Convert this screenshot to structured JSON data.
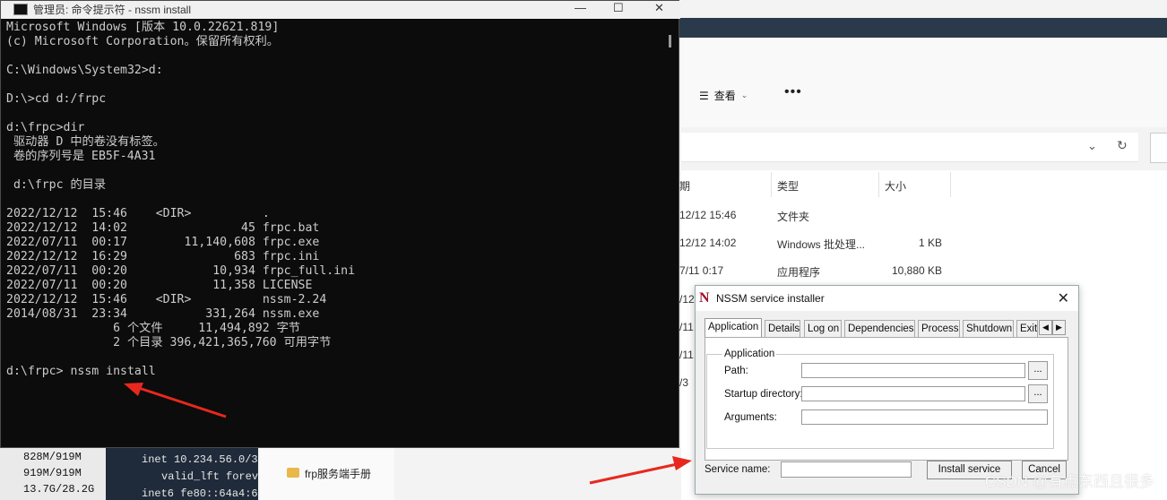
{
  "cmd": {
    "title": "管理员: 命令提示符 - nssm  install",
    "lines": [
      "Microsoft Windows [版本 10.0.22621.819]",
      "(c) Microsoft Corporation。保留所有权利。",
      "",
      "C:\\Windows\\System32>d:",
      "",
      "D:\\>cd d:/frpc",
      "",
      "d:\\frpc>dir",
      " 驱动器 D 中的卷没有标签。",
      " 卷的序列号是 EB5F-4A31",
      "",
      " d:\\frpc 的目录",
      "",
      "2022/12/12  15:46    <DIR>          .",
      "2022/12/12  14:02                45 frpc.bat",
      "2022/07/11  00:17        11,140,608 frpc.exe",
      "2022/12/12  16:29               683 frpc.ini",
      "2022/07/11  00:20            10,934 frpc_full.ini",
      "2022/07/11  00:20            11,358 LICENSE",
      "2022/12/12  15:46    <DIR>          nssm-2.24",
      "2014/08/31  23:34           331,264 nssm.exe",
      "               6 个文件     11,494,892 字节",
      "               2 个目录 396,421,365,760 可用字节",
      "",
      "d:\\frpc> nssm install"
    ]
  },
  "explorer": {
    "view_label": "查看",
    "columns": [
      "期",
      "类型",
      "大小"
    ],
    "rows": [
      {
        "date": "12/12 15:46",
        "type": "文件夹",
        "size": ""
      },
      {
        "date": "12/12 14:02",
        "type": "Windows 批处理...",
        "size": "1 KB"
      },
      {
        "date": "7/11 0:17",
        "type": "应用程序",
        "size": "10,880 KB"
      }
    ],
    "partial_dates": [
      "/12",
      "/11",
      "/11",
      "/3"
    ]
  },
  "bottom_left": {
    "mem": [
      "828M/919M",
      "919M/919M",
      "13.7G/28.2G"
    ],
    "terminal": [
      "inet 10.234.56.0/3",
      "valid_lft forev",
      "inet6 fe80::64a4:6"
    ],
    "folders": [
      "frp服务端手册"
    ]
  },
  "nssm": {
    "title": "NSSM service installer",
    "tabs": [
      "Application",
      "Details",
      "Log on",
      "Dependencies",
      "Process",
      "Shutdown",
      "Exit"
    ],
    "group_title": "Application",
    "path_label": "Path:",
    "startup_label": "Startup directory:",
    "args_label": "Arguments:",
    "browse_label": "...",
    "service_name_label": "Service name:",
    "install_button": "Install service",
    "cancel_button": "Cancel"
  },
  "watermark": "CSDN @有点东西且很多"
}
